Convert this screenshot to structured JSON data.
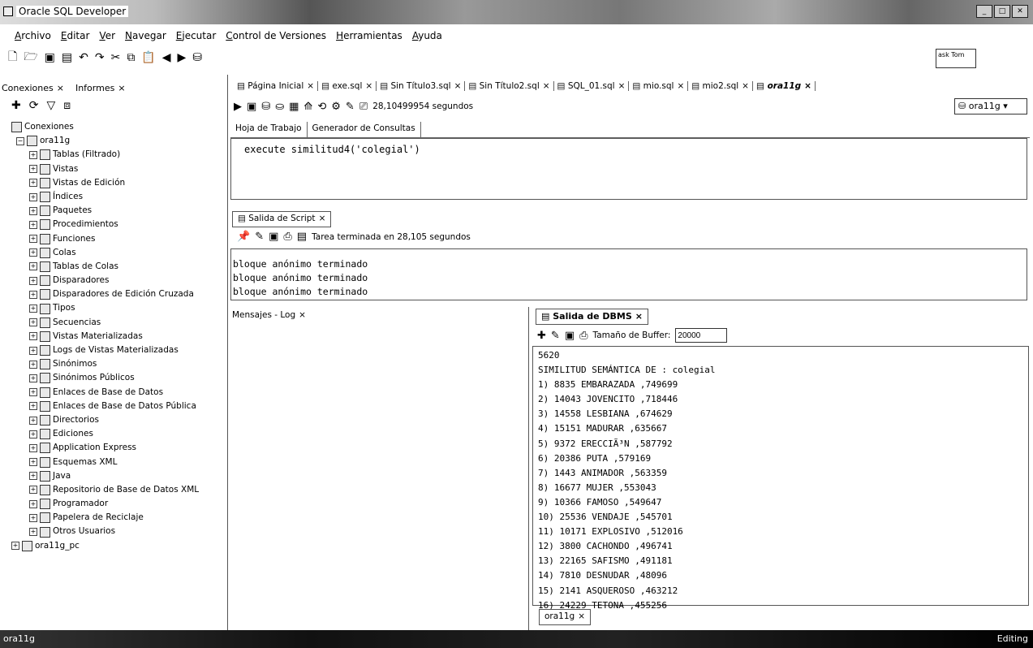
{
  "window": {
    "title": "Oracle SQL Developer"
  },
  "menu": [
    "Archivo",
    "Editar",
    "Ver",
    "Navegar",
    "Ejecutar",
    "Control de Versiones",
    "Herramientas",
    "Ayuda"
  ],
  "toolbar": {
    "asktom": "ask Tom"
  },
  "left": {
    "tabs": [
      "Conexiones",
      "Informes"
    ],
    "tree": [
      {
        "label": "Conexiones",
        "level": 0
      },
      {
        "label": "ora11g",
        "level": 1
      },
      {
        "label": "Tablas (Filtrado)",
        "level": 2
      },
      {
        "label": "Vistas",
        "level": 2
      },
      {
        "label": "Vistas de Edición",
        "level": 2
      },
      {
        "label": "Índices",
        "level": 2
      },
      {
        "label": "Paquetes",
        "level": 2
      },
      {
        "label": "Procedimientos",
        "level": 2
      },
      {
        "label": "Funciones",
        "level": 2
      },
      {
        "label": "Colas",
        "level": 2
      },
      {
        "label": "Tablas de Colas",
        "level": 2
      },
      {
        "label": "Disparadores",
        "level": 2
      },
      {
        "label": "Disparadores de Edición Cruzada",
        "level": 2
      },
      {
        "label": "Tipos",
        "level": 2
      },
      {
        "label": "Secuencias",
        "level": 2
      },
      {
        "label": "Vistas Materializadas",
        "level": 2
      },
      {
        "label": "Logs de Vistas Materializadas",
        "level": 2
      },
      {
        "label": "Sinónimos",
        "level": 2
      },
      {
        "label": "Sinónimos Públicos",
        "level": 2
      },
      {
        "label": "Enlaces de Base de Datos",
        "level": 2
      },
      {
        "label": "Enlaces de Base de Datos Pública",
        "level": 2
      },
      {
        "label": "Directorios",
        "level": 2
      },
      {
        "label": "Ediciones",
        "level": 2
      },
      {
        "label": "Application Express",
        "level": 2
      },
      {
        "label": "Esquemas XML",
        "level": 2
      },
      {
        "label": "Java",
        "level": 2
      },
      {
        "label": "Repositorio de Base de Datos XML",
        "level": 2
      },
      {
        "label": "Programador",
        "level": 2
      },
      {
        "label": "Papelera de Reciclaje",
        "level": 2
      },
      {
        "label": "Otros Usuarios",
        "level": 2
      },
      {
        "label": "ora11g_pc",
        "level": 0
      }
    ]
  },
  "editor": {
    "tabs": [
      "Página Inicial",
      "exe.sql",
      "Sin Título3.sql",
      "Sin Título2.sql",
      "SQL_01.sql",
      "mio.sql",
      "mio2.sql",
      "ora11g"
    ],
    "exec_time": "28,10499954 segundos",
    "connection": "ora11g",
    "subtabs": [
      "Hoja de Trabajo",
      "Generador de Consultas"
    ],
    "code": "execute similitud4('colegial')"
  },
  "script_output": {
    "tab": "Salida de Script",
    "status": "Tarea terminada en 28,105 segundos",
    "lines": [
      "bloque anónimo terminado",
      "bloque anónimo terminado",
      "bloque anónimo terminado"
    ]
  },
  "messages": {
    "tab": "Mensajes - Log"
  },
  "dbms": {
    "tab": "Salida de DBMS",
    "buffer_label": "Tamaño de Buffer:",
    "buffer_value": "20000",
    "lines": [
      "5620",
      "SIMILITUD SEMÁNTICA DE : colegial",
      "1) 8835 EMBARAZADA ,749699",
      "2) 14043 JOVENCITO ,718446",
      "3) 14558 LESBIANA ,674629",
      "4) 15151 MADURAR ,635667",
      "5) 9372 ERECCIÃ³N ,587792",
      "6) 20386 PUTA ,579169",
      "7) 1443 ANIMADOR ,563359",
      "8) 16677 MUJER ,553043",
      "9) 10366 FAMOSO ,549647",
      "10) 25536 VENDAJE ,545701",
      "11) 10171 EXPLOSIVO ,512016",
      "12) 3800 CACHONDO ,496741",
      "13) 22165 SAFISMO ,491181",
      "14) 7810 DESNUDAR ,48096",
      "15) 2141 ASQUEROSO ,463212",
      "16) 24229 TETONA ,455256"
    ],
    "bottom_tab": "ora11g"
  },
  "status": {
    "left": "ora11g",
    "right": "Editing"
  }
}
